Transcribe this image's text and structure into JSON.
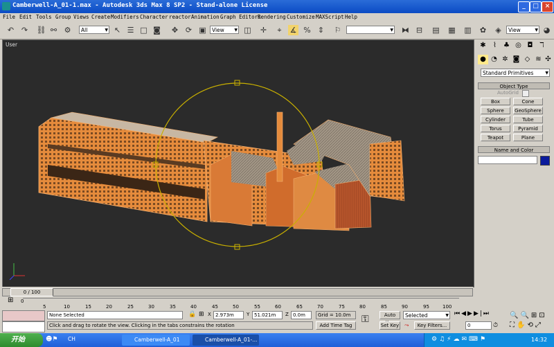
{
  "window": {
    "title": "Camberwell-A_01-1.max - Autodesk 3ds Max 8 SP2 - Stand-alone License",
    "controls": {
      "minimize": "_",
      "maximize": "□",
      "close": "×"
    }
  },
  "menu": [
    "File",
    "Edit",
    "Tools",
    "Group",
    "Views",
    "Create",
    "Modifiers",
    "Character",
    "reactor",
    "Animation",
    "Graph Editors",
    "Rendering",
    "Customize",
    "MAXScript",
    "Help"
  ],
  "toolbar": {
    "selection_filter": "All",
    "ref_coord": "View",
    "named_selection": "",
    "right_view": "View"
  },
  "viewport": {
    "label": "User"
  },
  "command_panel": {
    "category": "Standard Primitives",
    "object_type_title": "Object Type",
    "autogrid": "AutoGrid",
    "buttons": [
      "Box",
      "Cone",
      "Sphere",
      "GeoSphere",
      "Cylinder",
      "Tube",
      "Torus",
      "Pyramid",
      "Teapot",
      "Plane"
    ],
    "name_color_title": "Name and Color",
    "color": "#0b1b9c"
  },
  "timeline": {
    "frame_display": "0 / 100",
    "ticks": [
      "0",
      "5",
      "10",
      "15",
      "20",
      "25",
      "30",
      "35",
      "40",
      "45",
      "50",
      "55",
      "60",
      "65",
      "70",
      "75",
      "80",
      "85",
      "90",
      "95",
      "100"
    ]
  },
  "status": {
    "selection": "None Selected",
    "prompt": "Click and drag to rotate the view.  Clicking in the tabs constrains the rotation",
    "x_label": "X",
    "x_value": "2.973m",
    "y_label": "Y",
    "y_value": "51.021m",
    "z_label": "Z",
    "z_value": "0.0m",
    "grid": "Grid = 10.0m",
    "add_time_tag": "Add Time Tag",
    "auto_key": "Auto Key",
    "set_key": "Set Key",
    "key_mode": "Selected",
    "key_filters": "Key Filters...",
    "frame": "0"
  },
  "taskbar": {
    "start": "开始",
    "input_lang": "CH",
    "tasks": [
      "Camberwell-A_01",
      "Camberwell-A_01-..."
    ],
    "clock": "14:32"
  },
  "colors": {
    "building": "#f09a4a",
    "gizmo": "#c9b000",
    "viewport_bg": "#2b2b2b"
  }
}
